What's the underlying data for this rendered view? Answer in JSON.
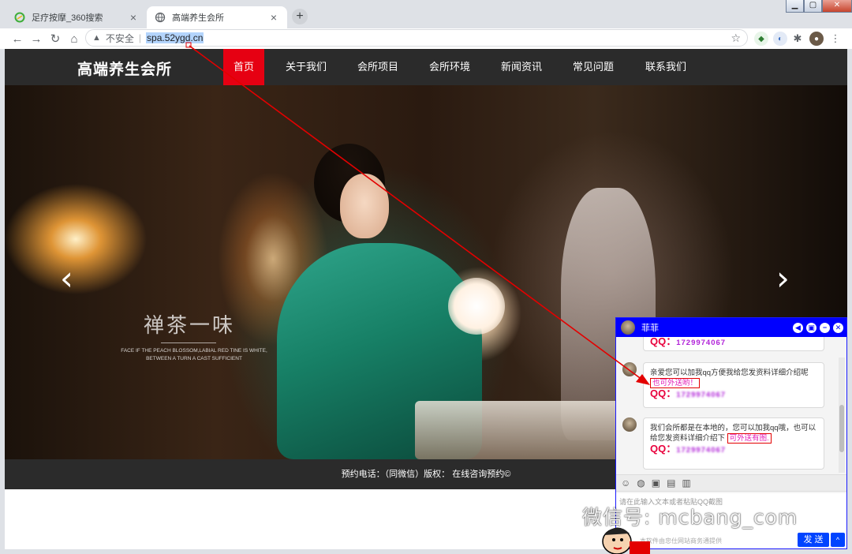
{
  "browser": {
    "tabs": [
      {
        "title": "足疗按摩_360搜索",
        "active": false
      },
      {
        "title": "高端养生会所",
        "active": true
      }
    ],
    "window_controls": {
      "minimize": "▁",
      "maximize": "▢",
      "close": "✕"
    },
    "security_label": "不安全",
    "url": "spa.52ygd.cn"
  },
  "site": {
    "logo": "高端养生会所",
    "menu": [
      "首页",
      "关于我们",
      "会所项目",
      "会所环境",
      "新闻资讯",
      "常见问题",
      "联系我们"
    ],
    "active_menu_index": 0,
    "hero": {
      "title": "禅茶一味",
      "subtitle": "FACE IF THE PEACH BLOSSOM,LABIAL RED TINE IS WHITE, BETWEEN A TURN A CAST SUFFICIENT",
      "prev": "‹",
      "next": "›"
    },
    "footer": "预约电话：（同微信）版权：  在线咨询预约©"
  },
  "chat": {
    "contact_name": "菲菲",
    "messages": [
      {
        "qq_label": "QQ：",
        "qq_number": "1729974067"
      },
      {
        "text": "亲爱您可以加我qq方便我给您发资料详细介绍呢",
        "highlight": "也可外送哟！",
        "qq_label": "QQ：",
        "qq_number": "1729974067"
      },
      {
        "text": "我们会所都是在本地的，您可以加我qq哦，也可以给您发资料详细介绍下",
        "highlight": "可外送有图.",
        "qq_label": "QQ：",
        "qq_number": "1729974067"
      }
    ],
    "input_placeholder": "请在此输入文本或者粘贴QQ截图",
    "powered_by": "本软件由忠仕网站商务通提供",
    "send_label": "发 送",
    "send_more": "^"
  },
  "watermark": "微信号: mcbang_com",
  "colors": {
    "nav_bg": "#2b2b2b",
    "menu_active": "#e60012",
    "chat_header": "#0000ff",
    "highlight_pink": "#e31fb8",
    "annotation_red": "#e30000"
  }
}
